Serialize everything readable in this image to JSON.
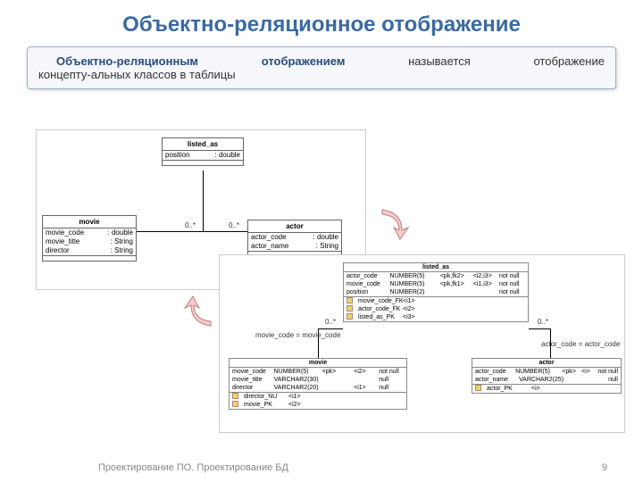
{
  "title": "Объектно-реляционное отображение",
  "definition": {
    "term": "Объектно-реляционным",
    "word2": "отображением",
    "word3": "называется",
    "word4": "отображение",
    "line2": "концепту-альных классов в таблицы"
  },
  "uml": {
    "listed_as": {
      "name": "listed_as",
      "a1n": "position",
      "a1t": ": double"
    },
    "movie": {
      "name": "movie",
      "a1n": "movie_code",
      "a1t": ": double",
      "a2n": "movie_title",
      "a2t": ": String",
      "a3n": "director",
      "a3t": ": String"
    },
    "actor": {
      "name": "actor",
      "a1n": "actor_code",
      "a1t": ": double",
      "a2n": "actor_name",
      "a2t": ": String"
    },
    "m1": "0..*",
    "m2": "0..*"
  },
  "db": {
    "listed_as": {
      "name": "listed_as",
      "r1": {
        "n": "actor_code",
        "t": "NUMBER(5)",
        "k": "<pk,fk2>",
        "i": "<i2,i3>",
        "nn": "not null"
      },
      "r2": {
        "n": "movie_code",
        "t": "NUMBER(5)",
        "k": "<pk,fk1>",
        "i": "<i1,i3>",
        "nn": "not null"
      },
      "r3": {
        "n": "position",
        "t": "NUMBER(2)",
        "k": "",
        "i": "",
        "nn": "not null"
      },
      "k1": "movie_code_FK",
      "i1": "<i1>",
      "k2": "actor_code_FK",
      "i2": "<i2>",
      "k3": "listed_as_PK",
      "i3": "<i3>"
    },
    "movie": {
      "name": "movie",
      "r1": {
        "n": "movie_code",
        "t": "NUMBER(5)",
        "k": "<pk>",
        "i": "<i2>",
        "nn": "not null"
      },
      "r2": {
        "n": "movie_title",
        "t": "VARCHAR2(30)",
        "k": "",
        "i": "",
        "nn": "null"
      },
      "r3": {
        "n": "director",
        "t": "VARCHAR2(20)",
        "k": "",
        "i": "<i1>",
        "nn": "null"
      },
      "k1": "director_NU",
      "i1": "<i1>",
      "k2": "movie_PK",
      "i2": "<i2>"
    },
    "actor": {
      "name": "actor",
      "r1": {
        "n": "actor_code",
        "t": "NUMBER(5)",
        "k": "<pk>",
        "i": "<i>",
        "nn": "not null"
      },
      "r2": {
        "n": "actor_name",
        "t": "VARCHAR2(25)",
        "k": "",
        "i": "",
        "nn": "null"
      },
      "k1": "actor_PK",
      "i1": "<i>"
    },
    "rel_left": "movie_code = movie_code",
    "rel_right": "actor_code = actor_code",
    "m1": "0..*",
    "m2": "0..*"
  },
  "footer": {
    "left": "Проектирование ПО. Проектирование БД",
    "page": "9"
  }
}
